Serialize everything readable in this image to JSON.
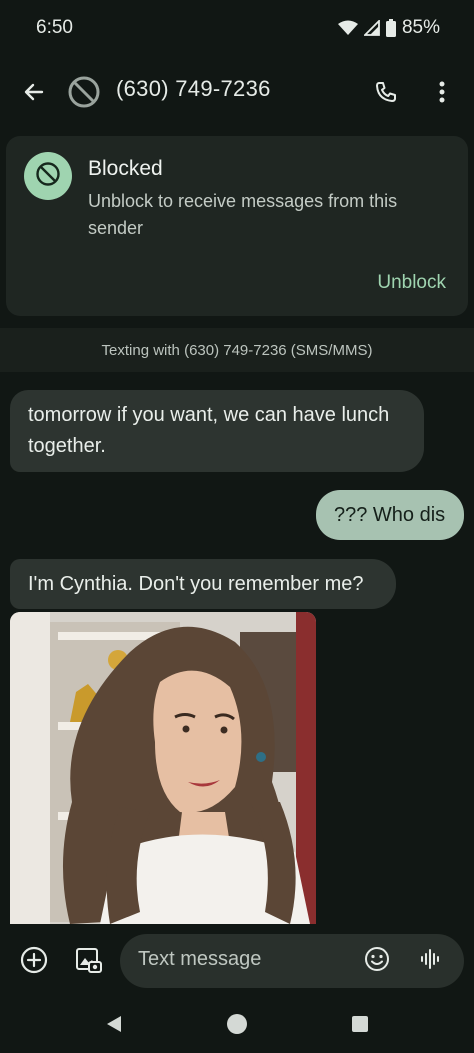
{
  "status_bar": {
    "time": "6:50",
    "battery": "85%"
  },
  "header": {
    "title": "(630) 749-7236"
  },
  "blocked_card": {
    "title": "Blocked",
    "description": "Unblock to receive messages from this sender",
    "unblock_label": "Unblock"
  },
  "conversation": {
    "texting_with": "Texting with (630) 749-7236 (SMS/MMS)",
    "messages": [
      {
        "direction": "incoming",
        "text": "tomorrow if you want, we can have lunch together."
      },
      {
        "direction": "outgoing",
        "text": "??? Who dis"
      },
      {
        "direction": "incoming",
        "text": "I'm Cynthia. Don't you remember me?"
      }
    ]
  },
  "compose": {
    "placeholder": "Text message"
  },
  "icons": {
    "back": "arrow-left-icon",
    "blocked": "block-icon",
    "call": "phone-icon",
    "more": "more-vertical-icon",
    "add": "add-circle-icon",
    "gallery": "gallery-icon",
    "emoji": "emoji-icon",
    "voice": "voice-waveform-icon"
  },
  "colors": {
    "background": "#111714",
    "card": "#1f2622",
    "accent": "#9fd4b0",
    "incoming_bubble": "#2d3430",
    "outgoing_bubble": "#a7c2b1"
  }
}
